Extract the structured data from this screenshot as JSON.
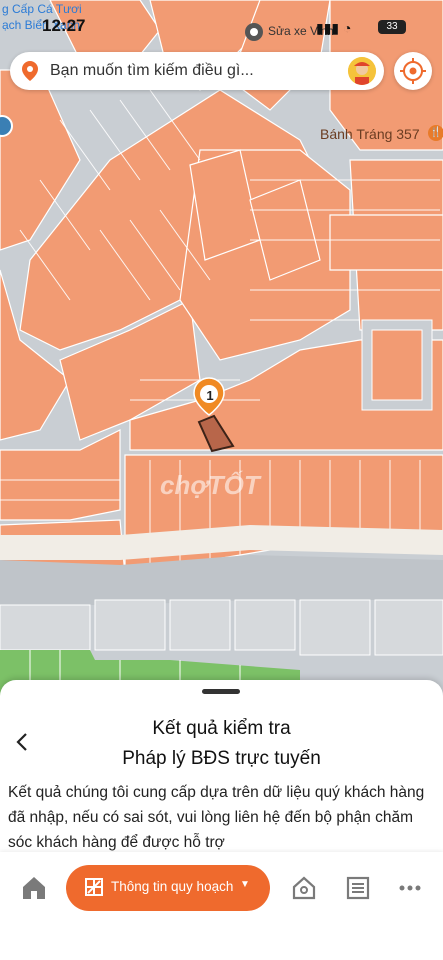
{
  "status_bar": {
    "time": "12:27",
    "top_place_line1": "g Cấp Cá Tươi",
    "top_place_line2": "ạch Biển Xanh",
    "right_label": "Sửa xe Vinh",
    "battery": "33"
  },
  "search": {
    "placeholder": "Bạn muốn tìm kiếm điều gì..."
  },
  "map": {
    "poi_label": "Bánh Tráng 357",
    "marker_number": "1",
    "watermark": "chợTỐT",
    "colors": {
      "parcel": "#f29b73",
      "parcel_border": "#ffffff",
      "road": "#c9ced3",
      "selected": "#b8664a",
      "marker": "#f08a24",
      "park": "#7cc167"
    }
  },
  "sheet": {
    "title_line1": "Kết quả kiểm tra",
    "title_line2": "Pháp lý BĐS trực tuyến",
    "body": "Kết quả chúng tôi cung cấp dựa trên dữ liệu quý khách hàng đã nhập, nếu có sai sót, vui lòng liên hệ đến bộ phận chăm sóc khách hàng để được hỗ trợ"
  },
  "nav": {
    "cta_label": "Thông tin quy hoạch",
    "cta_color": "#ef6a2d",
    "icons": [
      "home-icon",
      "map-grid-icon",
      "house-icon",
      "list-icon",
      "more-icon"
    ]
  }
}
